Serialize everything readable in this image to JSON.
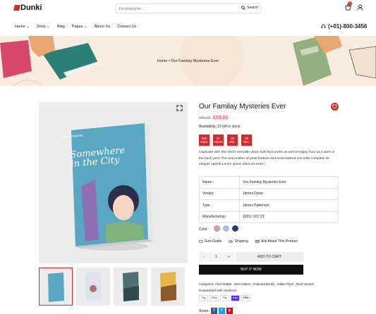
{
  "header": {
    "logo": "Dunki",
    "search_placeholder": "I'm looking for...",
    "search_label": "Search",
    "cart_count": "0",
    "phone": "(+01)-800-3456"
  },
  "nav": [
    "Home",
    "Shop",
    "Blog",
    "Pages",
    "About Us",
    "Contact Us"
  ],
  "breadcrumb": {
    "home": "Home",
    "sep": "•",
    "current": "Our Familay Mysteries Ever"
  },
  "product": {
    "title": "Our Familay Mysteries Ever",
    "old_price": "£80.00",
    "price": "£59.00",
    "availability": "Availability: 22 left in stock",
    "countdown": [
      {
        "value": "565",
        "unit": "Days"
      },
      {
        "value": "07",
        "unit": "Hours"
      },
      {
        "value": "29",
        "unit": "Min."
      },
      {
        "value": "29",
        "unit": "Sec."
      }
    ],
    "description": "Captivate with this shirt's versatile urban look that works as well at happy hour as it does in the back yard. The real mother of pearl buttons and embroidered crocodile complete its elegant appeal.Lorem ipsum dolor sit amet,/...",
    "specs": [
      {
        "label": "Name :",
        "value": "Our Familay Mysteries Ever"
      },
      {
        "label": "Vendor :",
        "value": "James Dylan"
      },
      {
        "label": "Type :",
        "value": "James Patterson"
      },
      {
        "label": "Manufacturing :",
        "value": "2023 / 10 / 21"
      }
    ],
    "color_label": "Color :",
    "colors": [
      "#e89a9a",
      "#a9bfdc",
      "#2f3b7a"
    ],
    "size_guide": "Size Guide",
    "shipping": "Shipping",
    "ask": "Ask About This Product",
    "qty_minus": "-",
    "qty": "1",
    "qty_plus": "+",
    "add_to_cart": "ADD TO CART",
    "buy_now": "BUY IT NOW",
    "categories": "Categories: Alice Walker , Best Sellers , Featured Books , Gillian Flynn , Most Viewed",
    "guarantee": "Guaranteed safe checkout:",
    "payments": [
      "Pay",
      "GPay",
      "Pay",
      "shop",
      "VISA"
    ],
    "share": "Share:",
    "book_cover_title": "Somewhere in the City",
    "book_cover_author": "TEAMSPIDERIS"
  },
  "colors": {
    "accent": "#d42a2a",
    "dark": "#111111",
    "banner": "#f8ece0"
  }
}
